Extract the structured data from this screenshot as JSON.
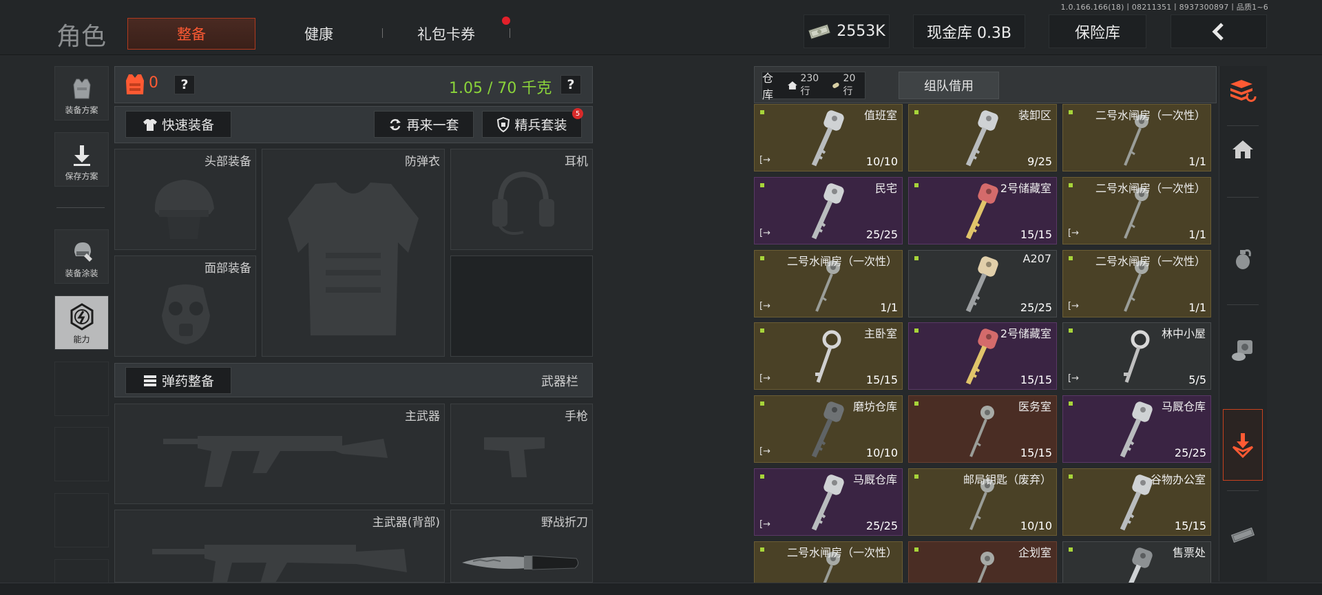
{
  "version": "1.0.166.166(18)丨08211351丨8937300897丨品质1~6",
  "page_title": "角色",
  "tabs": [
    {
      "label": "整备",
      "active": true
    },
    {
      "label": "健康",
      "active": false
    },
    {
      "label": "礼包卡券",
      "active": false,
      "notification": true
    }
  ],
  "top": {
    "money": "2553K",
    "cash_vault": "现金库 0.3B",
    "insurance_vault": "保险库",
    "back_icon": "chevron-left-icon"
  },
  "sidebar": [
    {
      "label": "装备方案",
      "icon": "vest-icon"
    },
    {
      "label": "保存方案",
      "icon": "download-icon"
    },
    {
      "label": "装备涂装",
      "icon": "helmet-paint-icon"
    },
    {
      "label": "能力",
      "icon": "ability-icon",
      "active": true
    }
  ],
  "equipment": {
    "armor_count": "0",
    "help": "?",
    "weight": "1.05 / 70 千克",
    "quick_equip": "快速装备",
    "again": "再来一套",
    "elite_set": "精兵套装",
    "elite_badge": "5",
    "slots": {
      "head": "头部装备",
      "armor": "防弹衣",
      "ear": "耳机",
      "face": "面部装备"
    },
    "ammo_equip": "弹药整备",
    "weapon_bar": "武器栏",
    "weapons": {
      "main": "主武器",
      "pistol": "手枪",
      "main_back": "主武器(背部)",
      "knife": "野战折刀"
    }
  },
  "storage": {
    "tab_label": "仓库",
    "rows_total": "230行",
    "rows_used": "20行",
    "team_borrow": "组队借用",
    "items": [
      {
        "name": "值班室",
        "count": "10/10",
        "color": "yellow",
        "key": "silver"
      },
      {
        "name": "装卸区",
        "count": "9/25",
        "color": "yellow",
        "key": "silver"
      },
      {
        "name": "二号水闸房（一次性）",
        "count": "1/1",
        "color": "yellow",
        "key": "thin"
      },
      {
        "name": "民宅",
        "count": "25/25",
        "color": "purple",
        "key": "silver"
      },
      {
        "name": "2号储藏室",
        "count": "15/15",
        "color": "purple",
        "key": "red"
      },
      {
        "name": "二号水闸房（一次性）",
        "count": "1/1",
        "color": "yellow",
        "key": "thin"
      },
      {
        "name": "二号水闸房（一次性）",
        "count": "1/1",
        "color": "yellow",
        "key": "thin"
      },
      {
        "name": "A207",
        "count": "25/25",
        "color": "gray",
        "key": "tan"
      },
      {
        "name": "二号水闸房（一次性）",
        "count": "1/1",
        "color": "yellow",
        "key": "thin"
      },
      {
        "name": "主卧室",
        "count": "15/15",
        "color": "yellow",
        "key": "old"
      },
      {
        "name": "2号储藏室",
        "count": "15/15",
        "color": "purple",
        "key": "red"
      },
      {
        "name": "林中小屋",
        "count": "5/5",
        "color": "gray",
        "key": "ring"
      },
      {
        "name": "磨坊仓库",
        "count": "10/10",
        "color": "yellow",
        "key": "dark"
      },
      {
        "name": "医务室",
        "count": "15/15",
        "color": "brown",
        "key": "thin"
      },
      {
        "name": "马厩仓库",
        "count": "25/25",
        "color": "purple",
        "key": "silver"
      },
      {
        "name": "马厩仓库",
        "count": "25/25",
        "color": "purple",
        "key": "silver"
      },
      {
        "name": "邮局钥匙（废弃）",
        "count": "10/10",
        "color": "yellow",
        "key": "thin"
      },
      {
        "name": "谷物办公室",
        "count": "15/15",
        "color": "yellow",
        "key": "silver"
      },
      {
        "name": "二号水闸房（一次性）",
        "count": "",
        "color": "yellow",
        "key": "thin"
      },
      {
        "name": "企划室",
        "count": "",
        "color": "brown",
        "key": "thin"
      },
      {
        "name": "售票处",
        "count": "",
        "color": "gray",
        "key": "gray"
      }
    ]
  },
  "right_nav": [
    "stack-refresh-icon",
    "home-icon",
    "grenade-icon",
    "ammo-box-icon",
    "sell-icon",
    "money-icon"
  ]
}
